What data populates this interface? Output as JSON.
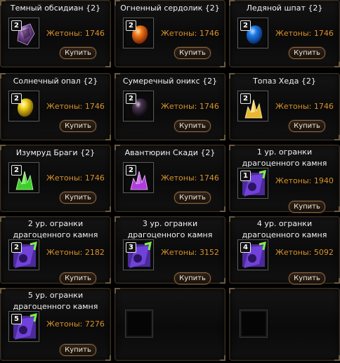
{
  "items": [
    {
      "title": "Темный обсидиан {2}",
      "badge": "2",
      "tokens": "Жетоны: 1746",
      "buy": "Купить",
      "icon": "obsidian-gem-icon",
      "color": "#8a5aa8"
    },
    {
      "title": "Огненный сердолик {2}",
      "badge": "2",
      "tokens": "Жетоны: 1746",
      "buy": "Купить",
      "icon": "carnelian-gem-icon",
      "color": "#ee6a14"
    },
    {
      "title": "Ледяной шпат {2}",
      "badge": "2",
      "tokens": "Жетоны: 1746",
      "buy": "Купить",
      "icon": "ice-spar-gem-icon",
      "color": "#1f7ce8"
    },
    {
      "title": "Солнечный опал {2}",
      "badge": "2",
      "tokens": "Жетоны: 1746",
      "buy": "Купить",
      "icon": "sun-opal-gem-icon",
      "color": "#f2d21a"
    },
    {
      "title": "Сумеречный оникс {2}",
      "badge": "2",
      "tokens": "Жетоны: 1746",
      "buy": "Купить",
      "icon": "twilight-onyx-gem-icon",
      "color": "#3a2a40"
    },
    {
      "title": "Топаз Хеда {2}",
      "badge": "2",
      "tokens": "Жетоны: 1746",
      "buy": "Купить",
      "icon": "topaz-crystal-icon",
      "color": "#e8b830"
    },
    {
      "title": "Изумруд Браги {2}",
      "badge": "2",
      "tokens": "Жетоны: 1746",
      "buy": "Купить",
      "icon": "emerald-crystal-icon",
      "color": "#3ccf2a"
    },
    {
      "title": "Авантюрин Скади {2}",
      "badge": "2",
      "tokens": "Жетоны: 1746",
      "buy": "Купить",
      "icon": "aventurine-crystal-icon",
      "color": "#b03ce0"
    },
    {
      "title": "1 ур. огранки драгоценного камня",
      "badge": "1",
      "tokens": "Жетоны: 1940",
      "buy": "Купить",
      "icon": "gem-cutting-scroll-icon",
      "color": "#6a3ad8"
    },
    {
      "title": "2 ур. огранки драгоценного камня",
      "badge": "2",
      "tokens": "Жетоны: 2182",
      "buy": "Купить",
      "icon": "gem-cutting-scroll-icon",
      "color": "#6a3ad8"
    },
    {
      "title": "3 ур. огранки драгоценного камня",
      "badge": "3",
      "tokens": "Жетоны: 3152",
      "buy": "Купить",
      "icon": "gem-cutting-scroll-icon",
      "color": "#6a3ad8"
    },
    {
      "title": "4 ур. огранки драгоценного камня",
      "badge": "4",
      "tokens": "Жетоны: 5092",
      "buy": "Купить",
      "icon": "gem-cutting-scroll-icon",
      "color": "#6a3ad8"
    },
    {
      "title": "5 ур. огранки драгоценного камня",
      "badge": "5",
      "tokens": "Жетоны: 7276",
      "buy": "Купить",
      "icon": "gem-cutting-scroll-icon",
      "color": "#6a3ad8"
    }
  ]
}
